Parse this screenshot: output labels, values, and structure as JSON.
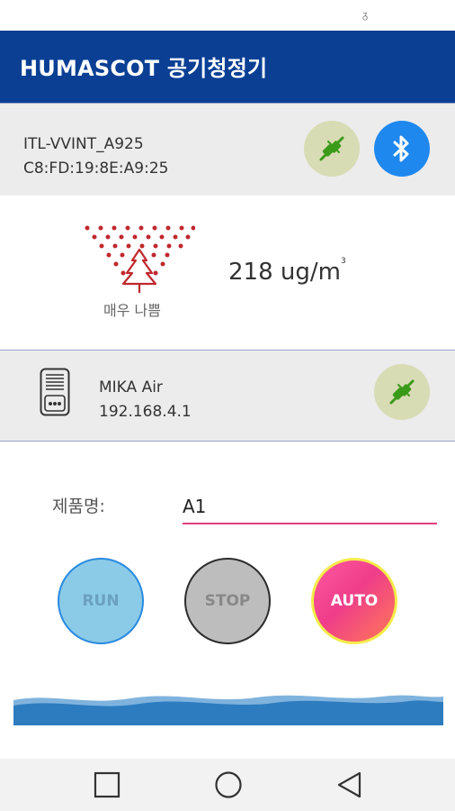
{
  "status_bar": {
    "icon": "signal-indicator-icon"
  },
  "app_bar": {
    "title": "HUMASCOT 공기청정기"
  },
  "bluetooth_panel": {
    "device_name": "ITL-VVINT_A925",
    "mac_address": "C8:FD:19:8E:A9:25",
    "connect_icon": "plug-connect-icon",
    "bluetooth_icon": "bluetooth-icon"
  },
  "air_quality": {
    "level_label": "매우 나쁨",
    "value_text": "218 ug/m",
    "unit_superscript": "3",
    "icon": "air-pollution-icon",
    "accent_color": "#c0282d"
  },
  "device_panel": {
    "name": "MIKA Air",
    "ip": "192.168.4.1",
    "device_icon": "air-purifier-icon",
    "connect_icon": "plug-connect-icon"
  },
  "product_form": {
    "label": "제품명:",
    "value": "A1"
  },
  "controls": {
    "run_label": "RUN",
    "stop_label": "STOP",
    "auto_label": "AUTO"
  },
  "colors": {
    "primary": "#0a3f94",
    "bluetooth": "#1f88ee",
    "plug_bg": "#d8dcb4",
    "plug_fg": "#3a9a1a",
    "wave": "#2d7cc0"
  },
  "nav_bar": {
    "recent": "recent-apps-icon",
    "home": "home-icon",
    "back": "back-icon"
  }
}
